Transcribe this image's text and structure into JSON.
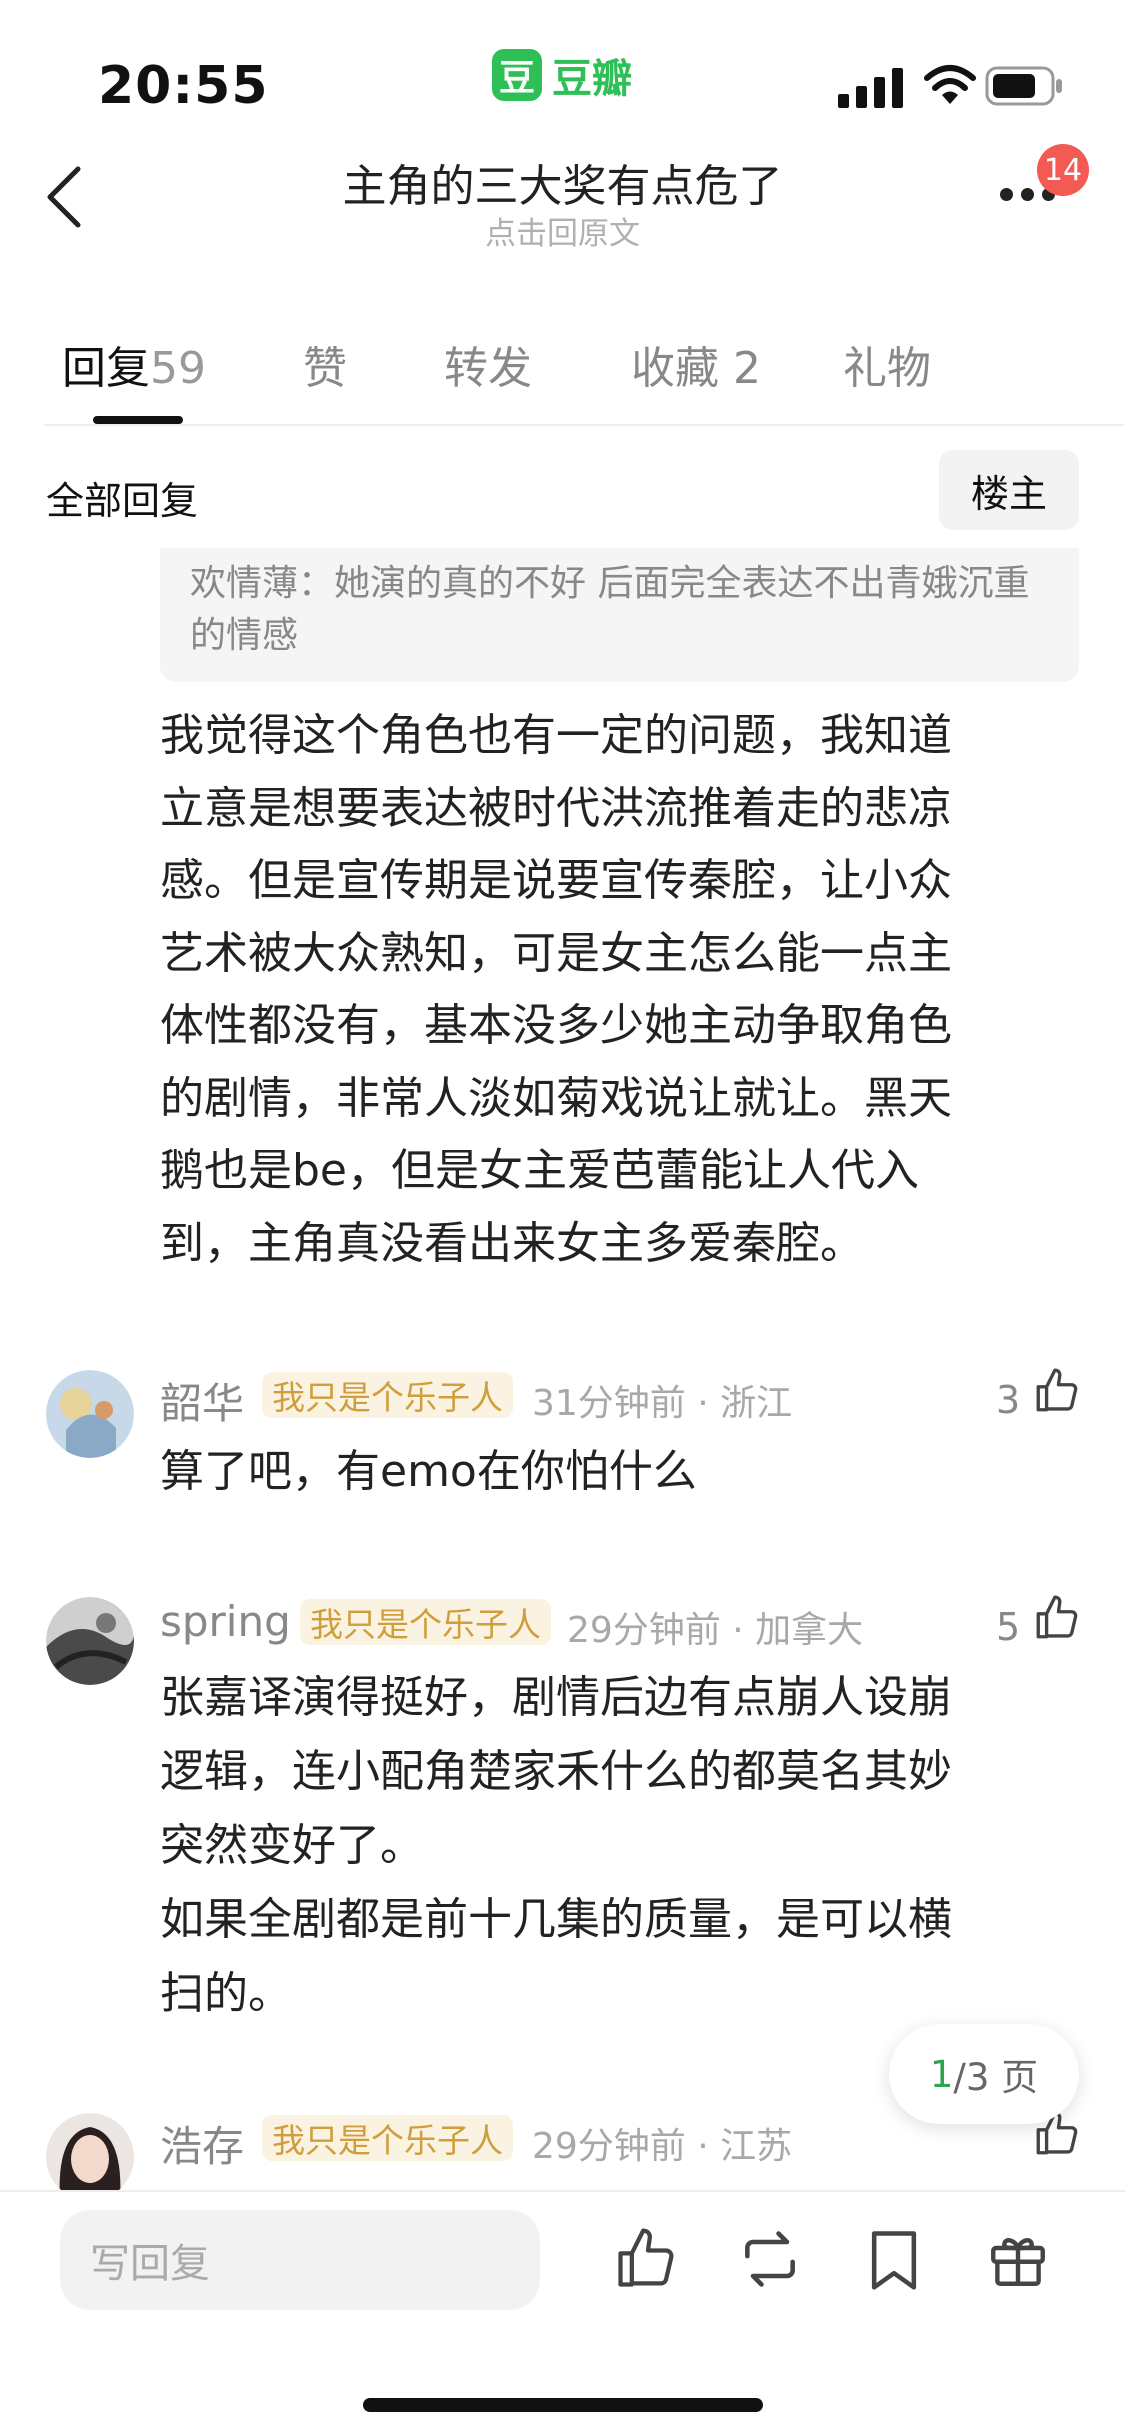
{
  "status_bar": {
    "time": "20:55"
  },
  "app": {
    "logo_char": "豆",
    "name": "豆瓣"
  },
  "header": {
    "title": "主角的三大奖有点危了",
    "subtitle": "点击回原文",
    "badge": "14"
  },
  "tabs": [
    {
      "label": "回复",
      "count": "59"
    },
    {
      "label": "赞"
    },
    {
      "label": "转发"
    },
    {
      "label": "收藏",
      "count": "2"
    },
    {
      "label": "礼物"
    }
  ],
  "section": {
    "all_replies": "全部回复",
    "op_filter": "楼主"
  },
  "quote": {
    "text": "欢情薄：她演的真的不好  后面完全表达不出青娥沉重的情感"
  },
  "main_reply": {
    "lines": [
      "我觉得这个角色也有一定的问题，我知道",
      "立意是想要表达被时代洪流推着走的悲凉",
      "感。但是宣传期是说要宣传秦腔，让小众",
      "艺术被大众熟知，可是女主怎么能一点主",
      "体性都没有，基本没多少她主动争取角色",
      "的剧情，非常人淡如菊戏说让就让。黑天",
      "鹅也是be，但是女主爱芭蕾能让人代入",
      "到，主角真没看出来女主多爱秦腔。"
    ]
  },
  "comments": [
    {
      "name": "韶华",
      "tag": "我只是个乐子人",
      "meta": "31分钟前 · 浙江",
      "likes": "3",
      "lines": [
        "算了吧，有emo在你怕什么"
      ]
    },
    {
      "name": "spring",
      "tag": "我只是个乐子人",
      "meta": "29分钟前 · 加拿大",
      "likes": "5",
      "lines": [
        "张嘉译演得挺好，剧情后边有点崩人设崩",
        "逻辑，连小配角楚家禾什么的都莫名其妙",
        "突然变好了。",
        "如果全剧都是前十几集的质量，是可以横",
        "扫的。"
      ]
    },
    {
      "name": "浩存",
      "tag": "我只是个乐子人",
      "meta": "29分钟前 · 江苏",
      "likes": "",
      "lines": []
    }
  ],
  "pager": {
    "current": "1",
    "rest": "/3 页"
  },
  "bottom_bar": {
    "reply_placeholder": "写回复"
  },
  "colors": {
    "accent": "#2fbf57",
    "tag_text": "#d09e3c",
    "tag_bg": "#fbf3e2",
    "badge": "#f25a52"
  }
}
